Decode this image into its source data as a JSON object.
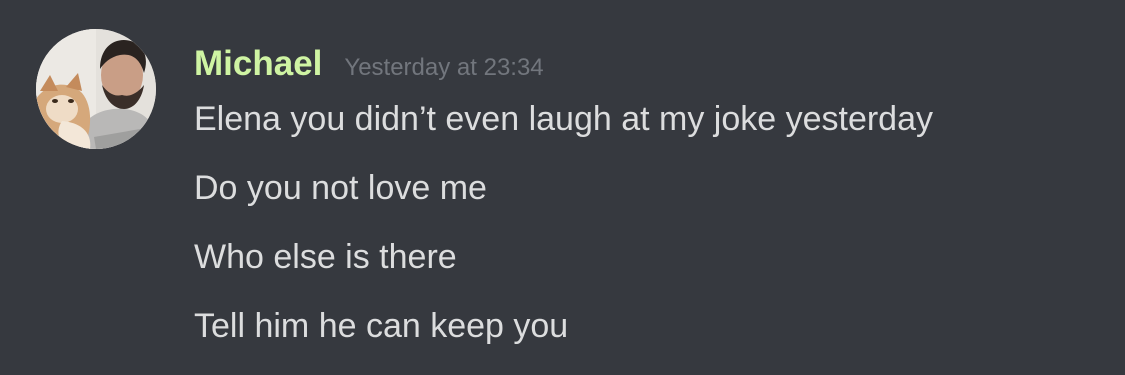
{
  "message": {
    "author": "Michael",
    "author_color": "#cff4a3",
    "timestamp": "Yesterday at 23:34",
    "lines": [
      "Elena you didn’t even laugh at my joke yesterday",
      "Do you not love me",
      "Who else is there",
      "Tell him he can keep you"
    ]
  },
  "colors": {
    "background": "#36393f",
    "message_text": "#dcddde",
    "timestamp_text": "#72767d"
  }
}
